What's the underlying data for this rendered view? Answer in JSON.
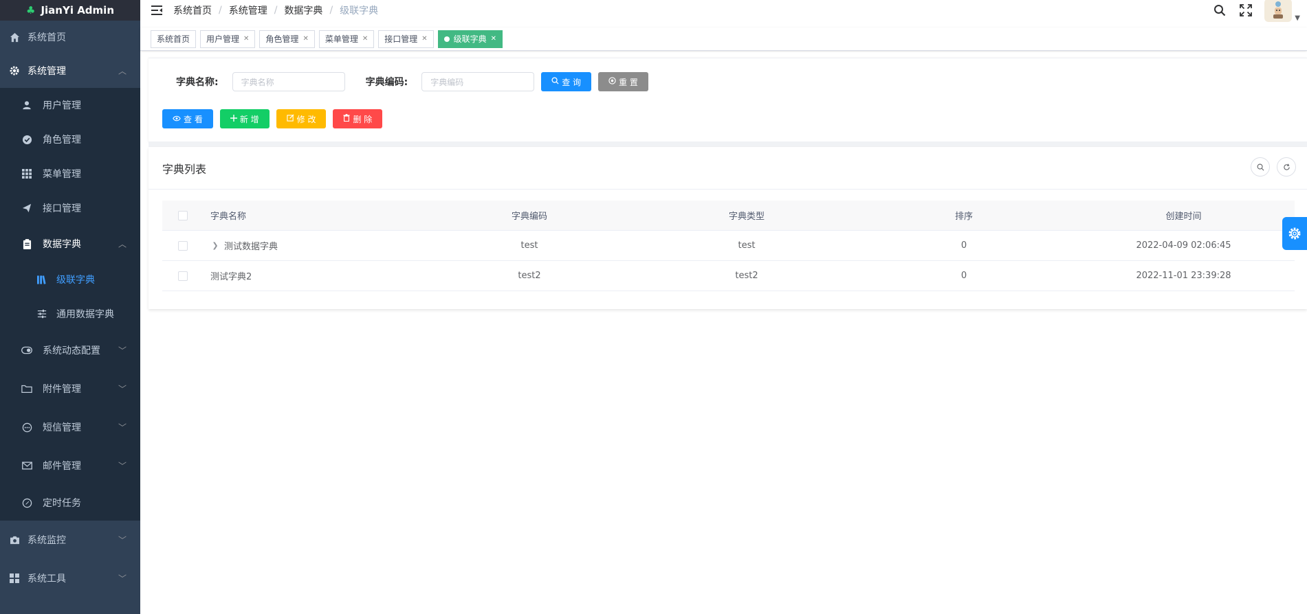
{
  "app": {
    "title": "JianYi Admin"
  },
  "sidebar": {
    "items": [
      {
        "label": "系统首页"
      },
      {
        "label": "系统管理"
      },
      {
        "label": "用户管理"
      },
      {
        "label": "角色管理"
      },
      {
        "label": "菜单管理"
      },
      {
        "label": "接口管理"
      },
      {
        "label": "数据字典"
      },
      {
        "label": "级联字典"
      },
      {
        "label": "通用数据字典"
      },
      {
        "label": "系统动态配置"
      },
      {
        "label": "附件管理"
      },
      {
        "label": "短信管理"
      },
      {
        "label": "邮件管理"
      },
      {
        "label": "定时任务"
      },
      {
        "label": "系统监控"
      },
      {
        "label": "系统工具"
      }
    ]
  },
  "breadcrumb": {
    "items": [
      "系统首页",
      "系统管理",
      "数据字典",
      "级联字典"
    ],
    "sep": "/"
  },
  "tags": [
    {
      "label": "系统首页"
    },
    {
      "label": "用户管理"
    },
    {
      "label": "角色管理"
    },
    {
      "label": "菜单管理"
    },
    {
      "label": "接口管理"
    },
    {
      "label": "级联字典"
    }
  ],
  "search": {
    "name_label": "字典名称:",
    "name_placeholder": "字典名称",
    "code_label": "字典编码:",
    "code_placeholder": "字典编码",
    "query_btn": "查 询",
    "reset_btn": "重 置"
  },
  "actions": {
    "view": "查 看",
    "add": "新 增",
    "edit": "修 改",
    "delete": "删 除"
  },
  "list": {
    "title": "字典列表",
    "columns": [
      "字典名称",
      "字典编码",
      "字典类型",
      "排序",
      "创建时间"
    ],
    "rows": [
      {
        "name": "测试数据字典",
        "code": "test",
        "type": "test",
        "sort": "0",
        "time": "2022-04-09 02:06:45"
      },
      {
        "name": "测试字典2",
        "code": "test2",
        "type": "test2",
        "sort": "0",
        "time": "2022-11-01 23:39:28"
      }
    ]
  },
  "colors": {
    "sidebar_bg": "#304156",
    "active": "#409eff",
    "tag_active": "#42b983",
    "primary": "#1890ff"
  }
}
